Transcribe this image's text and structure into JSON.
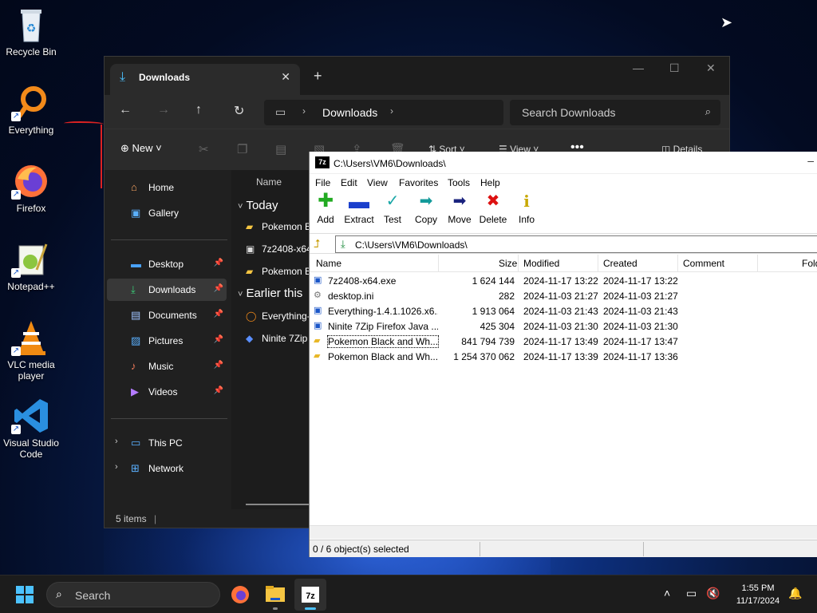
{
  "desktop": {
    "icons": [
      {
        "label": "Recycle Bin",
        "icon": "recycle-bin-icon"
      },
      {
        "label": "Everything",
        "icon": "everything-icon"
      },
      {
        "label": "Firefox",
        "icon": "firefox-icon"
      },
      {
        "label": "Notepad++",
        "icon": "notepad-plus-plus-icon"
      },
      {
        "label": "VLC media player",
        "icon": "vlc-icon"
      },
      {
        "label": "Visual Studio Code",
        "icon": "vscode-icon"
      }
    ]
  },
  "explorer": {
    "tab_title": "Downloads",
    "address_crumb": "Downloads",
    "search_placeholder": "Search Downloads",
    "cmd_new": "New",
    "cmd_sort": "Sort",
    "cmd_view": "View",
    "cmd_details": "Details",
    "sidebar": [
      {
        "label": "Home"
      },
      {
        "label": "Gallery"
      },
      {
        "label": "Desktop"
      },
      {
        "label": "Downloads"
      },
      {
        "label": "Documents"
      },
      {
        "label": "Pictures"
      },
      {
        "label": "Music"
      },
      {
        "label": "Videos"
      },
      {
        "label": "This PC"
      },
      {
        "label": "Network"
      }
    ],
    "column_name": "Name",
    "groups": [
      {
        "label": "Today"
      },
      {
        "label": "Earlier this"
      }
    ],
    "files": [
      {
        "name": "Pokemon B"
      },
      {
        "name": "7z2408-x64"
      },
      {
        "name": "Pokemon B"
      },
      {
        "name": "Everything-"
      },
      {
        "name": "Ninite 7Zip"
      }
    ],
    "status": "5 items"
  },
  "zip": {
    "title": "C:\\Users\\VM6\\Downloads\\",
    "menu": [
      "File",
      "Edit",
      "View",
      "Favorites",
      "Tools",
      "Help"
    ],
    "toolbar": [
      "Add",
      "Extract",
      "Test",
      "Copy",
      "Move",
      "Delete",
      "Info"
    ],
    "path": "C:\\Users\\VM6\\Downloads\\",
    "columns": [
      "Name",
      "Size",
      "Modified",
      "Created",
      "Comment",
      "Fold"
    ],
    "rows": [
      {
        "name": "7z2408-x64.exe",
        "size": "1 624 144",
        "modified": "2024-11-17 13:22",
        "created": "2024-11-17 13:22"
      },
      {
        "name": "desktop.ini",
        "size": "282",
        "modified": "2024-11-03 21:27",
        "created": "2024-11-03 21:27"
      },
      {
        "name": "Everything-1.4.1.1026.x6...",
        "size": "1 913 064",
        "modified": "2024-11-03 21:43",
        "created": "2024-11-03 21:43"
      },
      {
        "name": "Ninite 7Zip Firefox Java ...",
        "size": "425 304",
        "modified": "2024-11-03 21:30",
        "created": "2024-11-03 21:30"
      },
      {
        "name": "Pokemon Black and Wh...",
        "size": "841 794 739",
        "modified": "2024-11-17 13:49",
        "created": "2024-11-17 13:47"
      },
      {
        "name": "Pokemon Black and Wh...",
        "size": "1 254 370 062",
        "modified": "2024-11-17 13:39",
        "created": "2024-11-17 13:36"
      }
    ],
    "status": "0 / 6 object(s) selected"
  },
  "taskbar": {
    "search_label": "Search",
    "time": "1:55 PM",
    "date": "11/17/2024"
  },
  "colors": {
    "accent": "#4cc2ff",
    "explorer_bg": "#202020"
  }
}
